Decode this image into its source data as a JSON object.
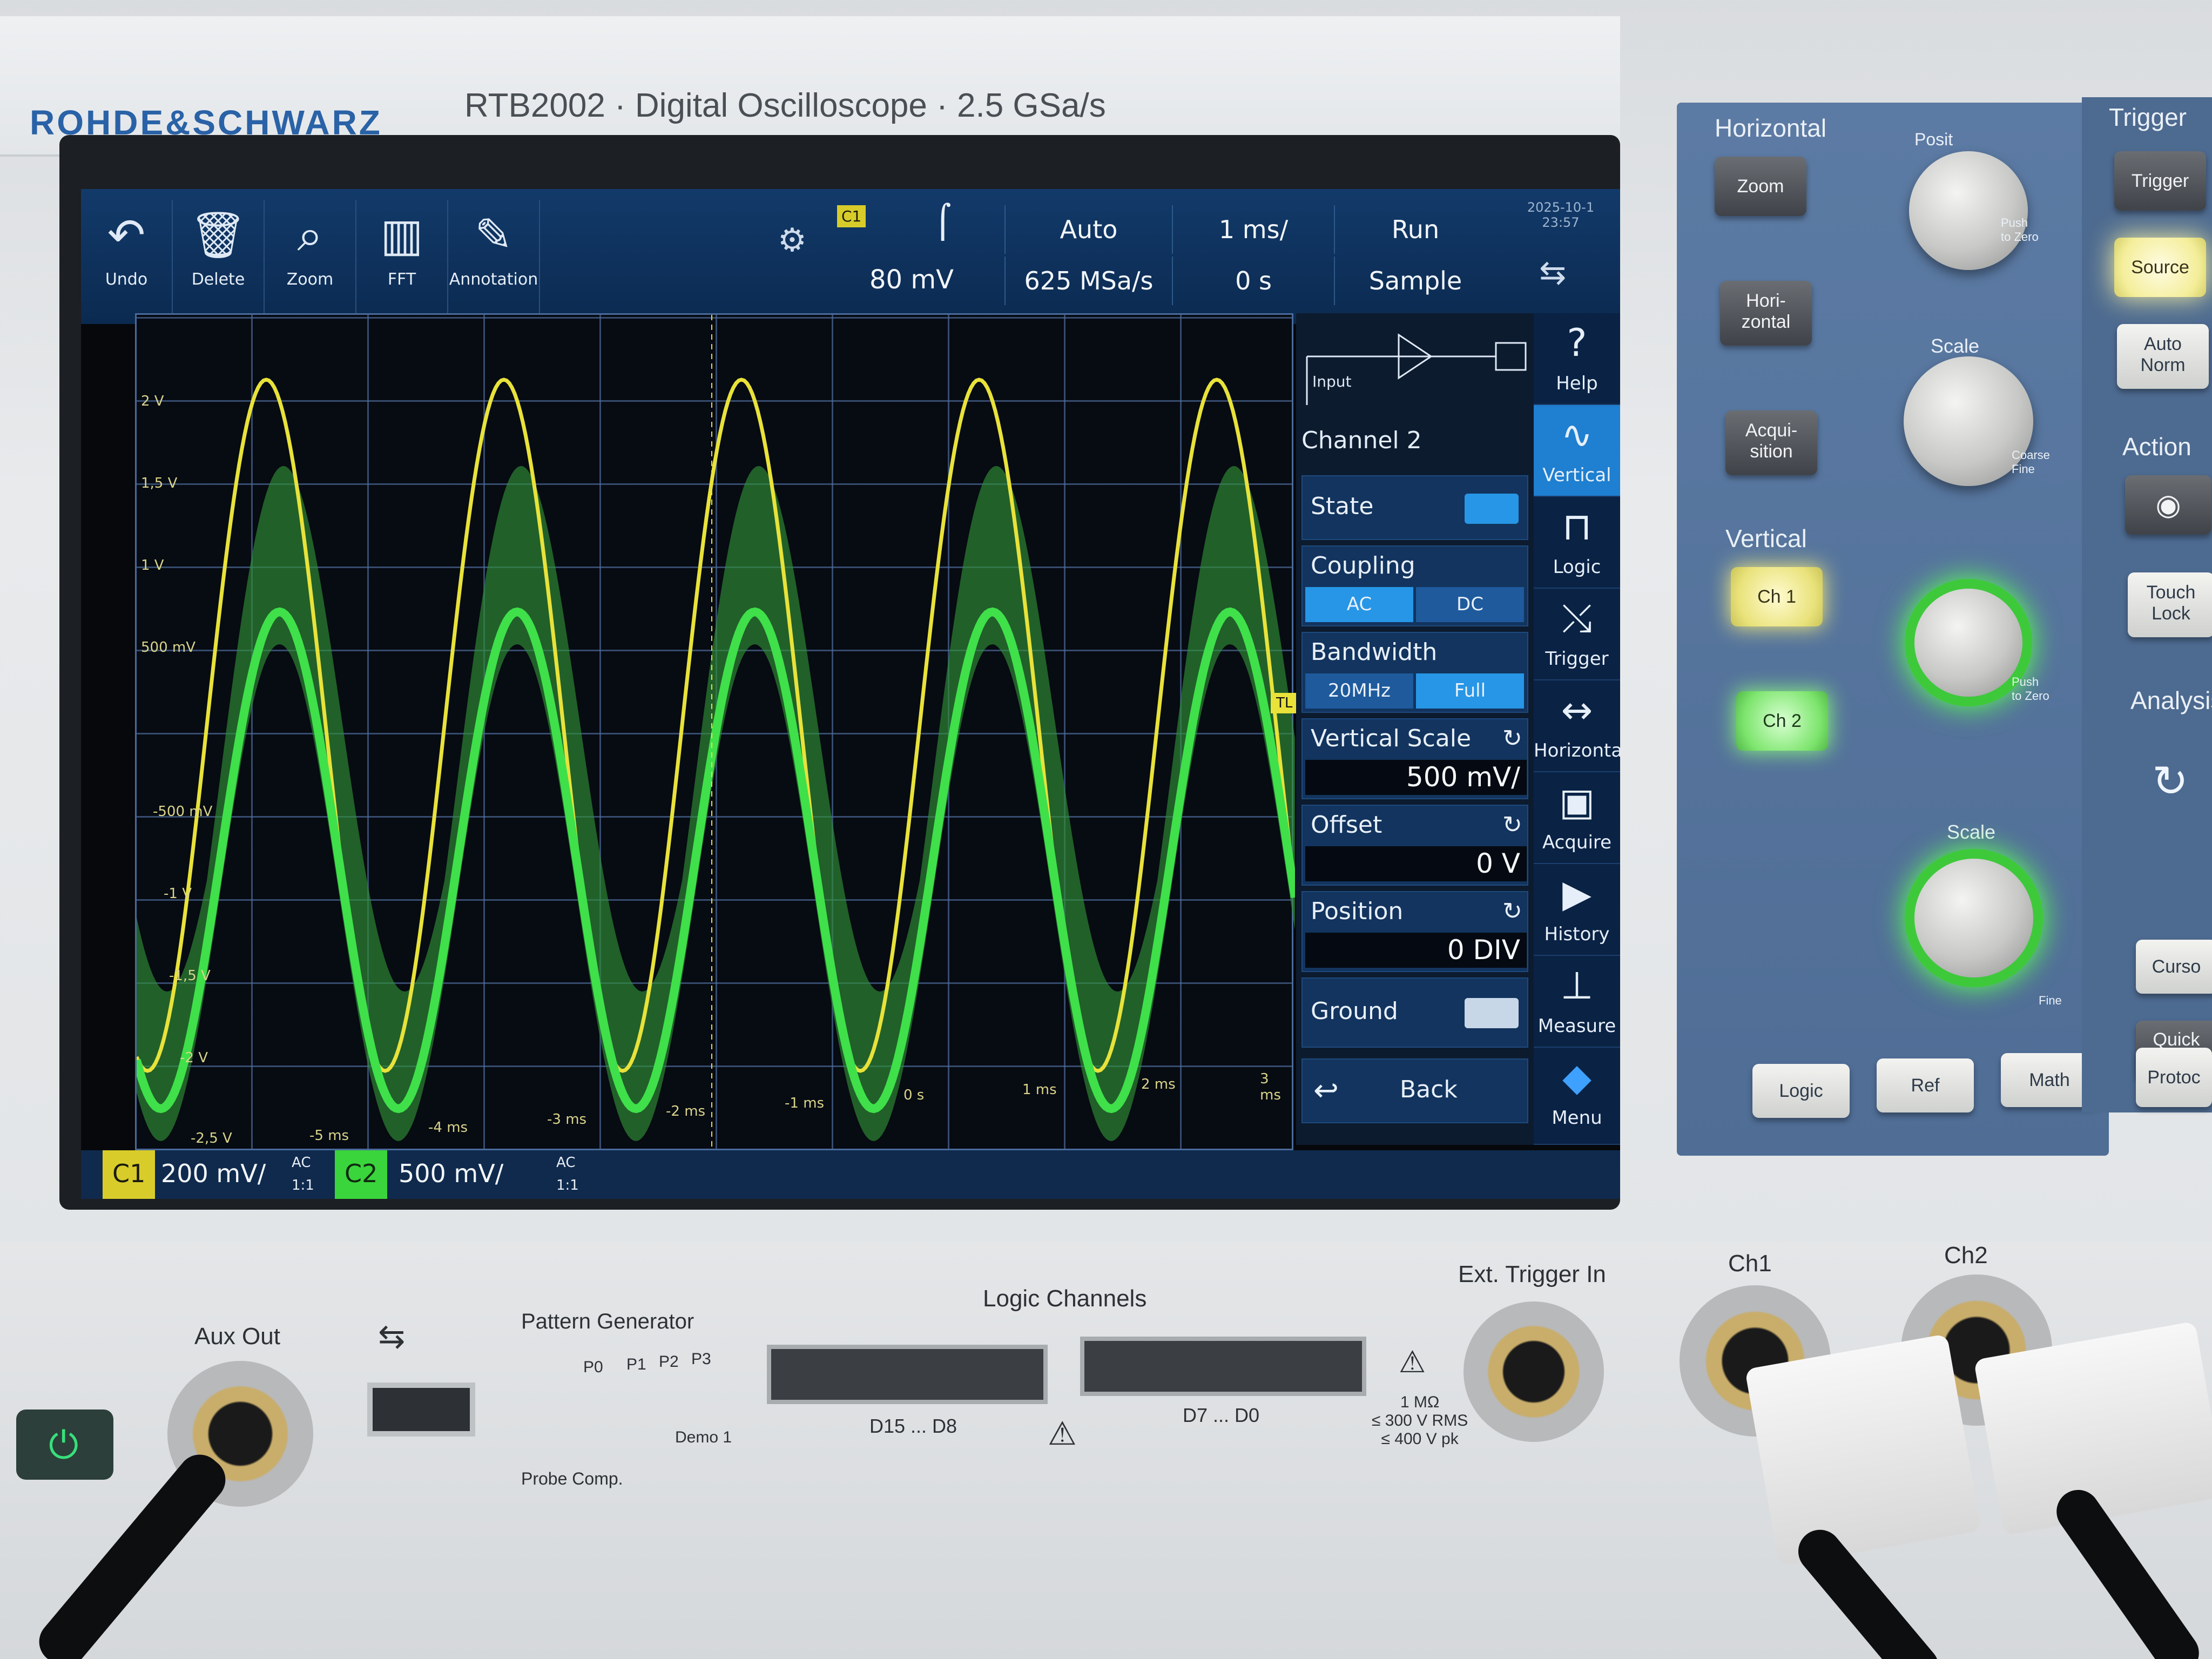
{
  "brand": {
    "logo": "ROHDE&SCHWARZ",
    "model": "RTB2002 · Digital Oscilloscope · 2.5 GSa/s"
  },
  "toolbar": {
    "tools": [
      {
        "icon": "undo-icon",
        "label": "Undo"
      },
      {
        "icon": "trash-icon",
        "label": "Delete"
      },
      {
        "icon": "zoom-icon",
        "label": "Zoom"
      },
      {
        "icon": "fft-icon",
        "label": "FFT"
      },
      {
        "icon": "pen-icon",
        "label": "Annotation"
      }
    ],
    "trigger_channel": "C1",
    "trigger_level": "80 mV",
    "trigger_mode": "Auto",
    "sample_rate": "625 MSa/s",
    "timebase": "1 ms/",
    "time_offset": "0 s",
    "run_state": "Run",
    "acq_mode": "Sample",
    "datetime": "2025-10-1 23:57"
  },
  "waveform": {
    "y_labels": [
      "2 V",
      "1,5 V",
      "1 V",
      "500 mV",
      "-500 mV",
      "-1 V",
      "-1,5 V",
      "-2 V",
      "-2,5 V"
    ],
    "x_labels": [
      "-5 ms",
      "-4 ms",
      "-3 ms",
      "-2 ms",
      "-1 ms",
      "0 s",
      "1 ms",
      "2 ms",
      "3 ms"
    ],
    "ch1_color": "#e8e23a",
    "ch2_color": "#3fe04a",
    "trigger_marker": "TL"
  },
  "side_menu": {
    "title": "Channel 2",
    "input_label": "Input",
    "state_label": "State",
    "coupling_label": "Coupling",
    "coupling_options": [
      "AC",
      "DC"
    ],
    "coupling_selected": "AC",
    "bandwidth_label": "Bandwidth",
    "bandwidth_options": [
      "20MHz",
      "Full"
    ],
    "bandwidth_selected": "Full",
    "vscale_label": "Vertical Scale",
    "vscale_value": "500 mV/",
    "offset_label": "Offset",
    "offset_value": "0 V",
    "position_label": "Position",
    "position_value": "0 DIV",
    "ground_label": "Ground",
    "back_label": "Back"
  },
  "icon_column": [
    {
      "icon": "help-icon",
      "label": "Help"
    },
    {
      "icon": "vertical-icon",
      "label": "Vertical"
    },
    {
      "icon": "logic-icon",
      "label": "Logic"
    },
    {
      "icon": "trigger-icon",
      "label": "Trigger"
    },
    {
      "icon": "horizontal-icon",
      "label": "Horizontal"
    },
    {
      "icon": "acquire-icon",
      "label": "Acquire"
    },
    {
      "icon": "history-icon",
      "label": "History"
    },
    {
      "icon": "measure-icon",
      "label": "Measure"
    },
    {
      "icon": "menu-icon",
      "label": "Menu"
    }
  ],
  "status": {
    "c1": "C1",
    "c1_scale": "200 mV/",
    "c1_coupling": "AC",
    "c1_probe": "1:1",
    "c2": "C2",
    "c2_scale": "500 mV/",
    "c2_coupling": "AC",
    "c2_probe": "1:1"
  },
  "panel": {
    "horizontal": "Horizontal",
    "zoom": "Zoom",
    "horizontal_btn": "Hori-\nzontal",
    "acquisition": "Acqui-\nsition",
    "position": "Posit",
    "push_zero": "Push\nto Zero",
    "scale": "Scale",
    "coarse_fine": "Coarse\nFine",
    "vertical": "Vertical",
    "ch1": "Ch 1",
    "ch2": "Ch 2",
    "scale2": "Scale",
    "fine": "Fine",
    "logic": "Logic",
    "ref": "Ref",
    "math": "Math",
    "trigger": "Trigger",
    "trigger_btn": "Trigger",
    "source": "Source",
    "auto_norm": "Auto\nNorm",
    "action": "Action",
    "touch_lock": "Touch\nLock",
    "analysis": "Analysis",
    "cursor": "Curso",
    "quick_meas": "Quick\nMeas",
    "protocol": "Protoc"
  },
  "front": {
    "aux_out": "Aux Out",
    "pattern_generator": "Pattern Generator",
    "p_labels": [
      "P0",
      "P1",
      "P2",
      "P3"
    ],
    "demo": "Demo 1",
    "probe_comp": "Probe Comp.",
    "logic_channels": "Logic Channels",
    "d15_d8": "D15 ... D8",
    "d7_d0": "D7 ... D0",
    "ext_trigger": "Ext. Trigger In",
    "ext_spec": "1 MΩ\n≤ 300 V RMS\n≤ 400 V pk",
    "ch1": "Ch1",
    "ch2": "Ch2"
  }
}
